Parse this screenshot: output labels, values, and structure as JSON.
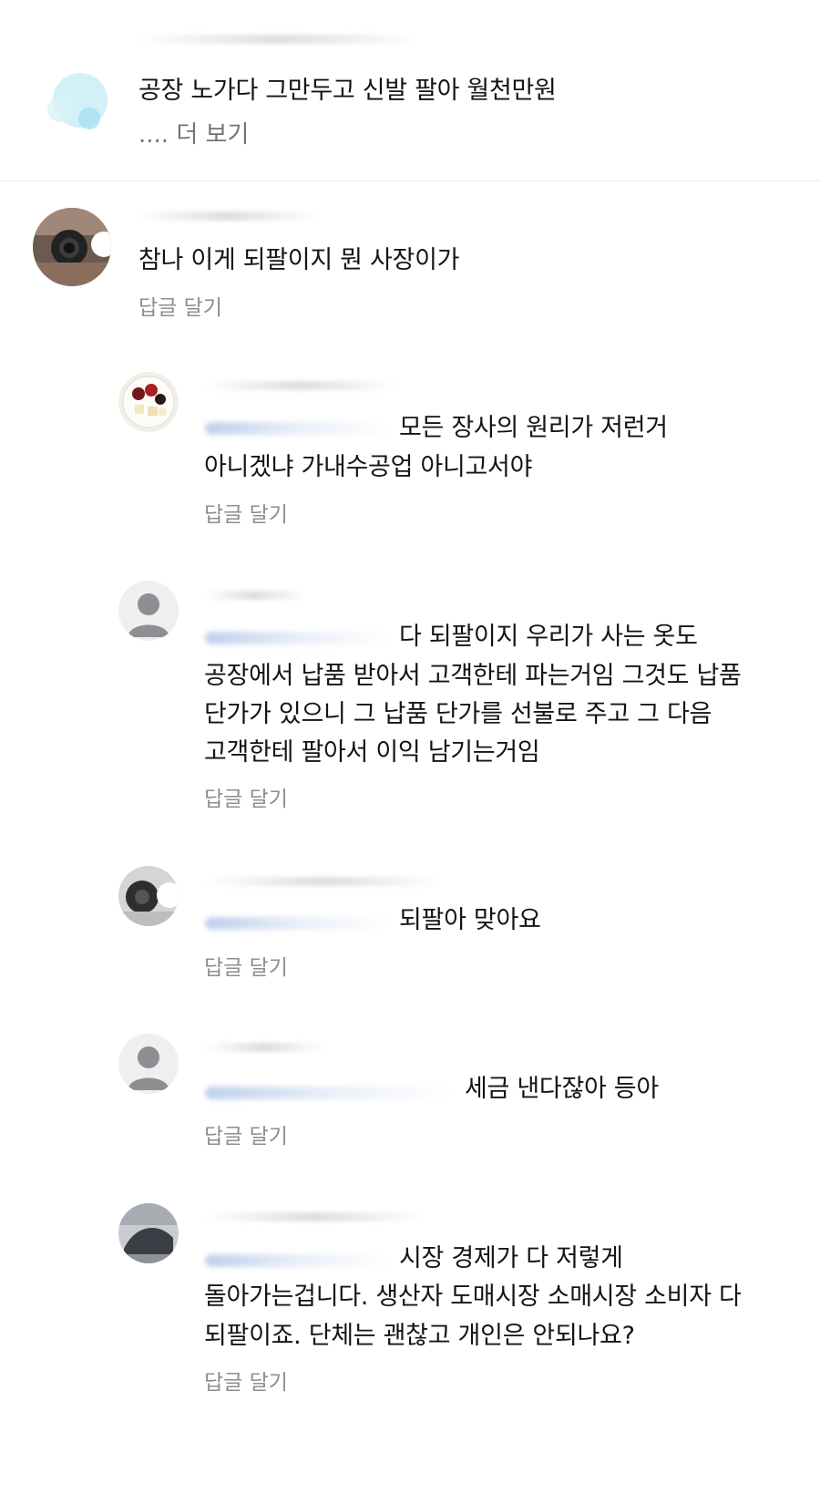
{
  "caption": {
    "text": "공장 노가다 그만두고 신발 팔아 월천만원",
    "more": ".... 더 보기"
  },
  "comments": [
    {
      "text": "참나 이게 되팔이지 뭔 사장이가",
      "reply": "답글 달기"
    },
    {
      "lines": [
        "모든 장사의 원리가 저런거",
        "아니겠냐 가내수공업 아니고서야"
      ],
      "reply": "답글 달기"
    },
    {
      "lines": [
        "다 되팔이지 우리가 사는 옷도",
        "공장에서 납품 받아서 고객한테 파는거임 그것도 납품",
        "단가가 있으니 그 납품 단가를 선불로 주고 그 다음",
        "고객한테 팔아서 이익 남기는거임"
      ],
      "reply": "답글 달기"
    },
    {
      "lines": [
        "되팔아 맞아요"
      ],
      "reply": "답글 달기"
    },
    {
      "lines": [
        "세금 낸다잖아 등아"
      ],
      "reply": "답글 달기"
    },
    {
      "lines": [
        "시장 경제가 다 저렇게",
        "돌아가는겁니다. 생산자 도매시장 소매시장 소비자 다",
        "되팔이죠. 단체는 괜찮고 개인은 안되나요?"
      ],
      "reply": "답글 달기"
    }
  ],
  "colors": {
    "text": "#141414",
    "muted": "#8e8e8e",
    "mention": "#3b6fbf",
    "divider": "#ececec"
  }
}
